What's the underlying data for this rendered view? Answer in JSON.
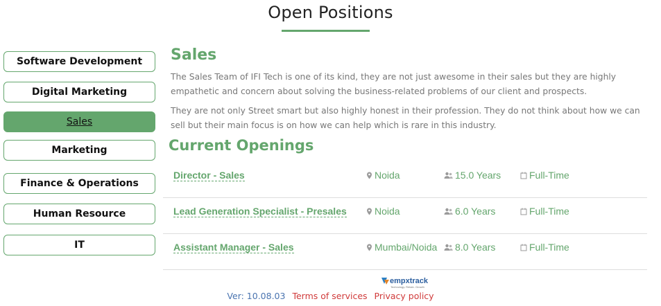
{
  "page": {
    "title": "Open Positions"
  },
  "departments": [
    {
      "label": "Software Development",
      "active": false
    },
    {
      "label": "Digital Marketing",
      "active": false
    },
    {
      "label": "Sales",
      "active": true
    },
    {
      "label": "Marketing",
      "active": false
    },
    {
      "label": "Finance & Operations",
      "active": false
    },
    {
      "label": "Human Resource",
      "active": false
    },
    {
      "label": "IT",
      "active": false
    }
  ],
  "section": {
    "title": "Sales",
    "paragraphs": [
      "The Sales Team of IFI Tech is one of its kind, they are not just awesome in their sales but they are highly empathetic and concern about solving the business-related problems of our client and prospects.",
      "They are not only Street smart but also highly honest in their profession. They do not think about how we can sell but their main focus is on how we can help which is rare in this industry."
    ]
  },
  "openings": {
    "title": "Current Openings",
    "jobs": [
      {
        "title": "Director - Sales",
        "location": "Noida",
        "experience": "15.0 Years",
        "type": "Full-Time"
      },
      {
        "title": "Lead Generation Specialist - Presales",
        "location": "Noida",
        "experience": "6.0 Years",
        "type": "Full-Time"
      },
      {
        "title": "Assistant Manager - Sales",
        "location": "Mumbai/Noida",
        "experience": "8.0 Years",
        "type": "Full-Time"
      }
    ]
  },
  "footer": {
    "logo_text": "empxtrack",
    "logo_tagline": "Technology. Retain. Growth",
    "version": "Ver: 10.08.03",
    "terms_label": "Terms of services",
    "privacy_label": "Privacy policy"
  },
  "colors": {
    "accent": "#64a66d",
    "body_text": "#777777",
    "link_red": "#d03a3a",
    "version_blue": "#4a74b0"
  }
}
